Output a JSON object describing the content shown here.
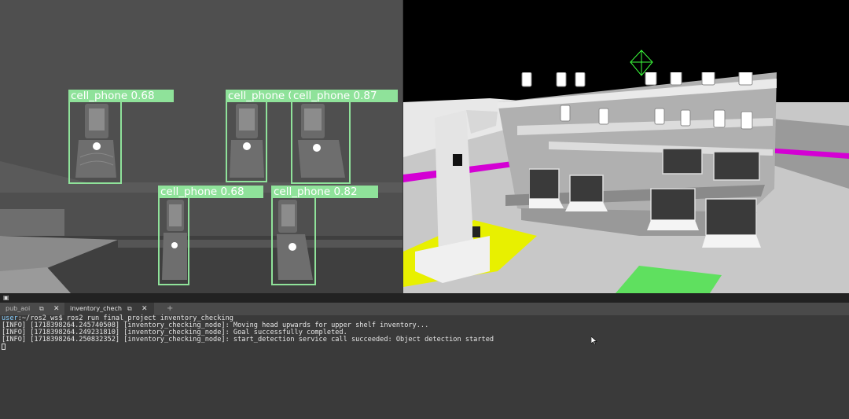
{
  "detection_view": {
    "boxes": [
      {
        "label": "cell_phone 0.68"
      },
      {
        "label": "cell_phone 0.93"
      },
      {
        "label": "cell_phone 0.87"
      },
      {
        "label": "cell_phone 0.68"
      },
      {
        "label": "cell_phone 0.82"
      }
    ]
  },
  "terminal": {
    "tabs": [
      {
        "label": "pub_aoi",
        "active": false
      },
      {
        "label": "inventory_chech",
        "active": true
      }
    ],
    "add_tab_label": "+",
    "prompt_user": "user",
    "prompt_path": ":~/ros2_ws$",
    "command": " ros2 run final_project inventory_checking",
    "output_lines": [
      "[INFO] [1718398264.245740508] [inventory_checking_node]: Moving head upwards for upper shelf inventory...",
      "[INFO] [1718398264.249231810] [inventory_checking_node]: Goal successfully completed.",
      "[INFO] [1718398264.250832352] [inventory_checking_node]: start_detection service call succeeded: Object detection started"
    ]
  },
  "colors": {
    "bbox": "#8fe29a",
    "prompt_user": "#8ad0ff",
    "terminal_bg": "#3a3a3a",
    "magenta_line": "#d400d4",
    "yellow_floor": "#e8f000",
    "green_floor": "#5fe05f"
  },
  "icons": [
    "terminal-icon",
    "pop-out-icon",
    "close-icon",
    "plus-icon",
    "mouse-pointer-icon",
    "cell-phone-icon",
    "laptop-icon",
    "robot-icon",
    "goal-marker-icon"
  ]
}
